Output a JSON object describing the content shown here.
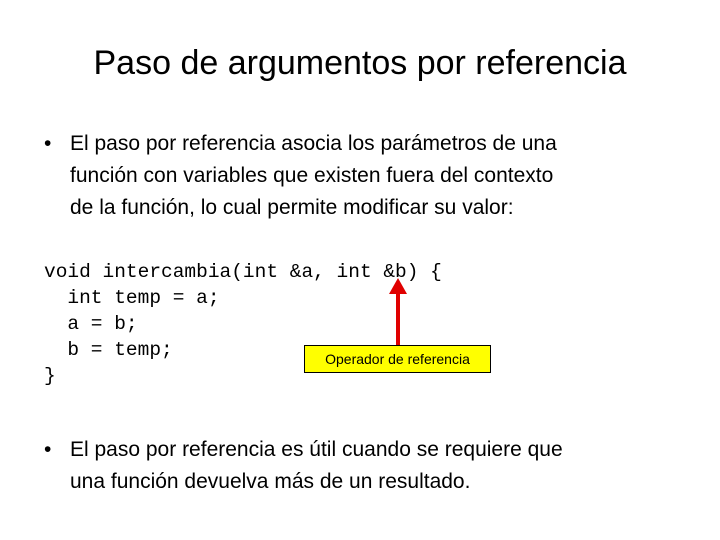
{
  "title": "Paso de argumentos por referencia",
  "bullets": [
    {
      "lines": [
        "El paso por referencia asocia los parámetros de una",
        "función con variables que existen fuera del contexto",
        "de la función, lo cual permite modificar su valor:"
      ]
    },
    {
      "lines": [
        "El paso por referencia es útil cuando se requiere que",
        "una función devuelva más de un resultado."
      ]
    }
  ],
  "code": [
    "void intercambia(int &a, int &b) {",
    "  int temp = a;",
    "  a = b;",
    "  b = temp;",
    "}"
  ],
  "callout": {
    "label": "Operador de referencia",
    "background": "#ffff00",
    "arrow_color": "#e00000"
  }
}
